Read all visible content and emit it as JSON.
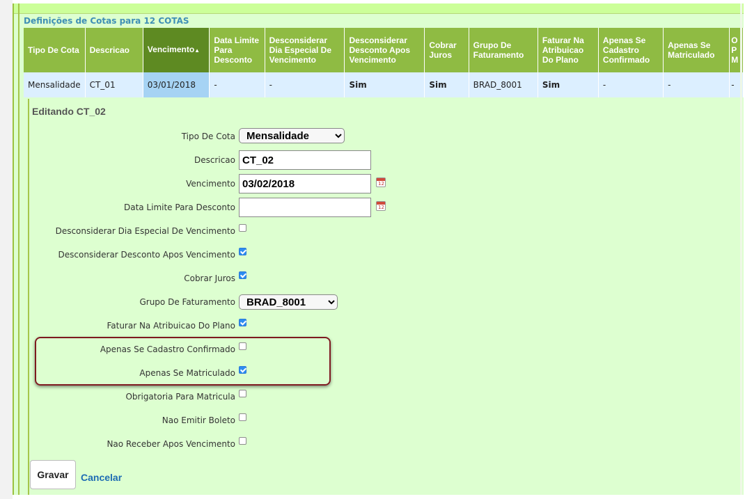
{
  "section_title": "Definições de Cotas para 12 COTAS",
  "table": {
    "headers": [
      "Tipo De Cota",
      "Descricao",
      "Vencimento",
      "Data Limite Para Desconto",
      "Desconsiderar Dia Especial De Vencimento",
      "Desconsiderar Desconto Apos Vencimento",
      "Cobrar Juros",
      "Grupo De Faturamento",
      "Faturar Na Atribuicao Do Plano",
      "Apenas Se Cadastro Confirmado",
      "Apenas Se Matriculado",
      "O P M"
    ],
    "sort_indicator": "▲",
    "row": [
      "Mensalidade",
      "CT_01",
      "03/01/2018",
      "-",
      "-",
      "Sim",
      "Sim",
      "BRAD_8001",
      "Sim",
      "-",
      "-",
      "-"
    ]
  },
  "editor": {
    "title": "Editando CT_02",
    "tipo_label": "Tipo De Cota",
    "tipo_value": "Mensalidade",
    "descricao_label": "Descricao",
    "descricao_value": "CT_02",
    "vencimento_label": "Vencimento",
    "vencimento_value": "03/02/2018",
    "data_limite_label": "Data Limite Para Desconto",
    "data_limite_value": "",
    "calendar_icon_text": "12",
    "checkboxes": [
      {
        "label": "Desconsiderar Dia Especial De Vencimento",
        "checked": false
      },
      {
        "label": "Desconsiderar Desconto Apos Vencimento",
        "checked": true
      },
      {
        "label": "Cobrar Juros",
        "checked": true
      }
    ],
    "grupo_label": "Grupo De Faturamento",
    "grupo_value": "BRAD_8001",
    "checkboxes2": [
      {
        "label": "Faturar Na Atribuicao Do Plano",
        "checked": true
      },
      {
        "label": "Apenas Se Cadastro Confirmado",
        "checked": false
      },
      {
        "label": "Apenas Se Matriculado",
        "checked": true
      },
      {
        "label": "Obrigatoria Para Matricula",
        "checked": false
      },
      {
        "label": "Nao Emitir Boleto",
        "checked": false
      },
      {
        "label": "Nao Receber Apos Vencimento",
        "checked": false
      }
    ],
    "save_label": "Gravar",
    "cancel_label": "Cancelar"
  },
  "colors": {
    "header_green": "#8fbb43",
    "sorted_header": "#5e8a22",
    "row_blue": "#dcefff",
    "panel_green": "#ddffd0",
    "highlight_border": "#7e1a20",
    "link_blue": "#1d6bb3",
    "checkbox_blue": "#2e8cf0"
  }
}
